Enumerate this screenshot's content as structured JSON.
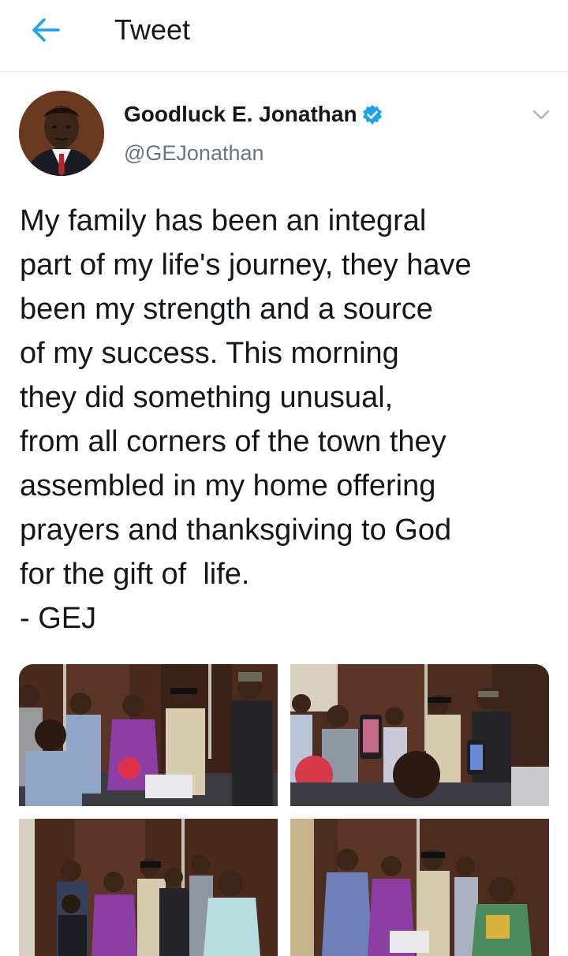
{
  "header": {
    "title": "Tweet",
    "back_icon": "back-arrow-icon",
    "accent": "#1da1f2"
  },
  "tweet": {
    "author": {
      "name": "Goodluck E. Jonathan",
      "handle": "@GEJonathan",
      "verified": true
    },
    "text_lines": [
      "My family has been an integral",
      "part of my life's journey, they have",
      "been my strength and a source",
      "of my success. This morning",
      "they did something unusual,",
      "from all corners of the town they",
      "assembled in my home offering",
      "prayers and thanksgiving to God",
      "for the gift of  life.",
      "- GEJ"
    ],
    "photos": [
      {
        "icon": "photo-family-gathering-1"
      },
      {
        "icon": "photo-family-gathering-2"
      },
      {
        "icon": "photo-family-gathering-3"
      },
      {
        "icon": "photo-family-gathering-4"
      }
    ]
  }
}
